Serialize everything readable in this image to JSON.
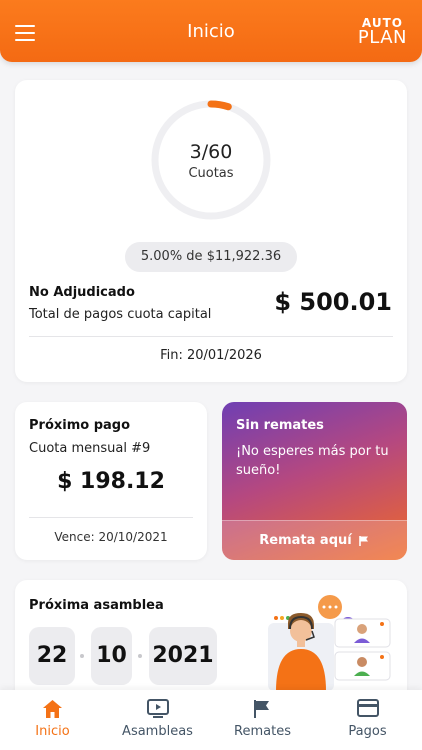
{
  "header": {
    "title": "Inicio",
    "logo_line1": "AUTO",
    "logo_line2": "PLAN",
    "menu_icon": "menu-icon"
  },
  "summary": {
    "paid_count": "3/60",
    "paid_label": "Cuotas",
    "progress_paid": 3,
    "progress_total": 60,
    "percent_text": "5.00% de $11,922.36",
    "status": "No Adjudicado",
    "total_label": "Total de pagos cuota capital",
    "total_amount": "$ 500.01",
    "end_date": "Fin: 20/01/2026"
  },
  "next_payment": {
    "title": "Próximo pago",
    "subtitle": "Cuota mensual #9",
    "amount": "$ 198.12",
    "due": "Vence: 20/10/2021"
  },
  "promo": {
    "title": "Sin remates",
    "text": "¡No esperes más por tu sueño!",
    "button_label": "Remata aquí",
    "button_icon": "flag-icon"
  },
  "assembly": {
    "title": "Próxima asamblea",
    "day": "22",
    "month": "10",
    "year": "2021",
    "illustration": "support-agent-illustration"
  },
  "nav": {
    "items": [
      {
        "label": "Inicio",
        "icon": "home-icon",
        "active": true
      },
      {
        "label": "Asambleas",
        "icon": "tv-icon",
        "active": false
      },
      {
        "label": "Remates",
        "icon": "flag-icon",
        "active": false
      },
      {
        "label": "Pagos",
        "icon": "card-icon",
        "active": false
      }
    ]
  },
  "colors": {
    "accent": "#f47216",
    "promo_gradient_start": "#6f3fb3",
    "promo_gradient_end": "#f06a27",
    "nav_inactive": "#445566"
  }
}
